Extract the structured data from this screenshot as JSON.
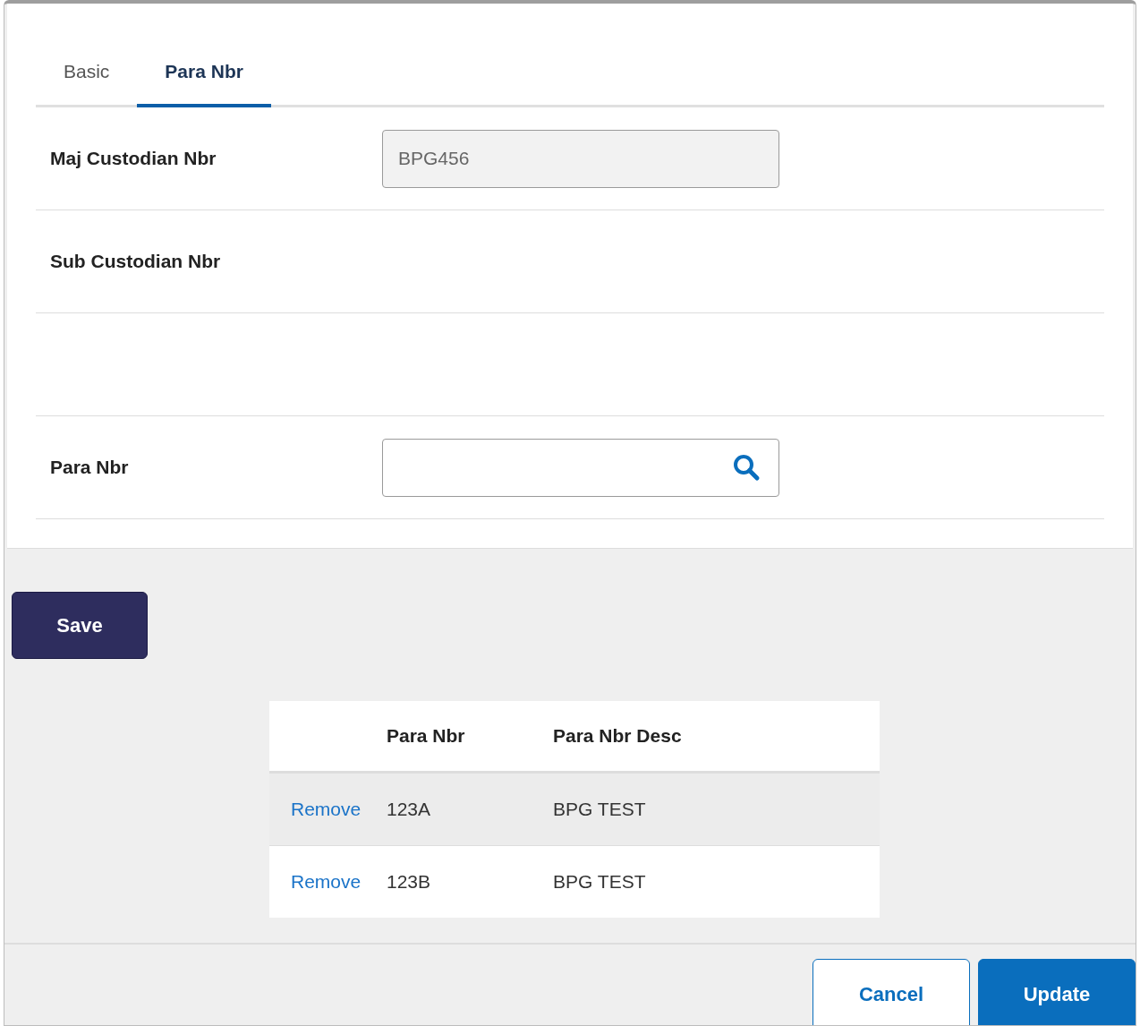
{
  "tabs": [
    {
      "label": "Basic",
      "selected": false
    },
    {
      "label": "Para Nbr",
      "selected": true
    }
  ],
  "form": {
    "rows": [
      {
        "kind": "field",
        "label": "Maj Custodian Nbr",
        "value": "BPG456",
        "disabled": true
      },
      {
        "kind": "label",
        "label": "Sub Custodian Nbr"
      },
      {
        "kind": "empty"
      },
      {
        "kind": "search",
        "label": "Para Nbr",
        "value": "",
        "disabled": false
      }
    ]
  },
  "save_button": "Save",
  "table": {
    "columns": [
      "Para Nbr",
      "Para Nbr Desc"
    ],
    "rows": [
      {
        "action": "Remove",
        "para_nbr": "123A",
        "desc": "BPG TEST"
      },
      {
        "action": "Remove",
        "para_nbr": "123B",
        "desc": "BPG TEST"
      }
    ]
  },
  "footer": {
    "cancel": "Cancel",
    "update": "Update"
  }
}
